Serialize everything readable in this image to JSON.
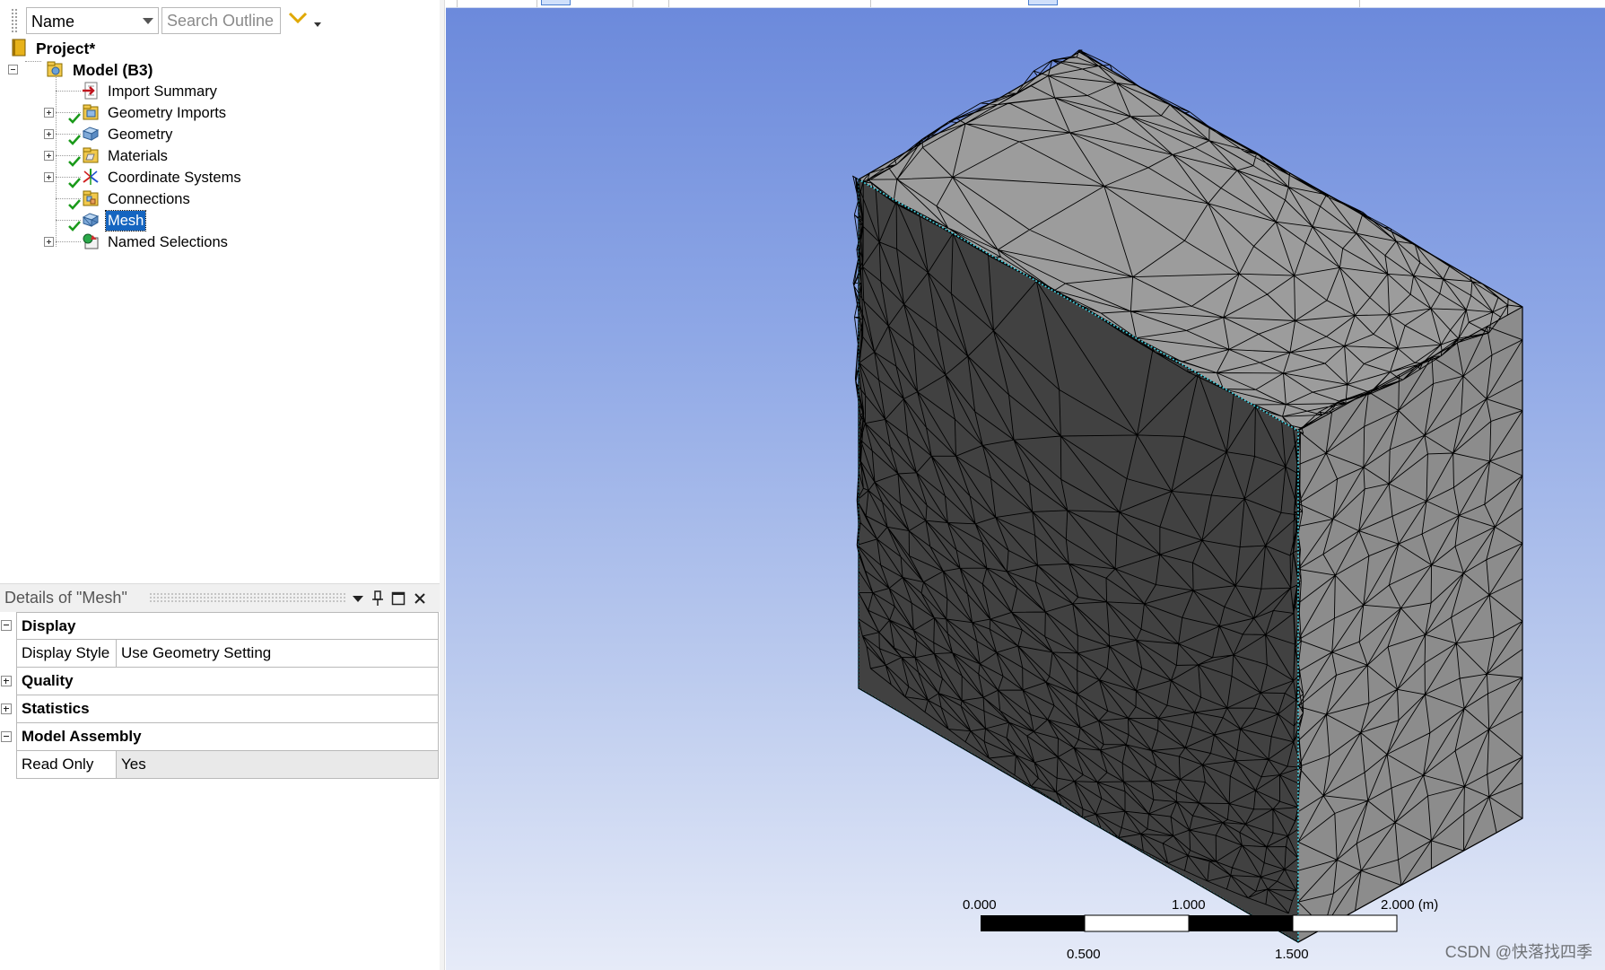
{
  "outline": {
    "column_selector": "Name",
    "search_placeholder": "Search Outline",
    "tree": [
      {
        "label": "Project*",
        "icon": "project-icon",
        "bold": true
      },
      {
        "label": "Model (B3)",
        "icon": "model-icon",
        "bold": true,
        "expanded": true
      },
      {
        "label": "Import Summary",
        "icon": "import-summary-icon"
      },
      {
        "label": "Geometry Imports",
        "icon": "geometry-imports-icon",
        "status": "ok"
      },
      {
        "label": "Geometry",
        "icon": "geometry-icon",
        "status": "ok"
      },
      {
        "label": "Materials",
        "icon": "materials-icon",
        "status": "ok"
      },
      {
        "label": "Coordinate Systems",
        "icon": "coordinate-systems-icon",
        "status": "ok"
      },
      {
        "label": "Connections",
        "icon": "connections-icon",
        "status": "ok"
      },
      {
        "label": "Mesh",
        "icon": "mesh-icon",
        "status": "ok",
        "selected": true
      },
      {
        "label": "Named Selections",
        "icon": "named-selections-icon"
      }
    ]
  },
  "details": {
    "title": "Details of \"Mesh\"",
    "sections": {
      "display": {
        "label": "Display",
        "expanded": true
      },
      "display_style": {
        "label": "Display Style",
        "value": "Use Geometry Setting"
      },
      "quality": {
        "label": "Quality",
        "expanded": false
      },
      "statistics": {
        "label": "Statistics",
        "expanded": false
      },
      "model_assembly": {
        "label": "Model Assembly",
        "expanded": true
      },
      "read_only": {
        "label": "Read Only",
        "value": "Yes"
      }
    }
  },
  "viewport": {
    "scale_bar": {
      "top_labels": [
        "0.000",
        "1.000",
        "2.000 (m)"
      ],
      "bottom_labels": [
        "0.500",
        "1.500"
      ]
    },
    "watermark": "CSDN @快落找四季",
    "colors": {
      "background_top": "#6b89db",
      "background_bottom": "#e6ebf8",
      "front_face": "#414141",
      "top_face": "#9c9c9c",
      "side_face": "#8c8c8c",
      "mesh_edge": "#000000",
      "selection_edge": "#40d0e0"
    }
  }
}
